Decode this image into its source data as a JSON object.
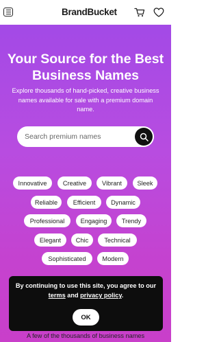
{
  "header": {
    "logo": "BrandBucket"
  },
  "hero": {
    "title_line1": "Your Source for the Best",
    "title_line2": "Business Names",
    "subtitle_line1": "Explore thousands of hand-picked, creative business",
    "subtitle_line2": "names available for sale with a premium domain",
    "subtitle_line3": "name."
  },
  "search": {
    "placeholder": "Search premium names"
  },
  "tags": [
    "Innovative",
    "Creative",
    "Vibrant",
    "Sleek",
    "Reliable",
    "Efficient",
    "Dynamic",
    "Professional",
    "Engaging",
    "Trendy",
    "Elegant",
    "Chic",
    "Technical",
    "Sophisticated",
    "Modern"
  ],
  "below_text": "A few of the thousands of business names",
  "cookie": {
    "text_before": "By continuing to use this site, you agree to our ",
    "terms_link": "terms",
    "text_middle": " and ",
    "privacy_link": "privacy policy",
    "text_after": ".",
    "ok_label": "OK"
  },
  "colors": {
    "gradient_top": "#a34ae6",
    "gradient_bottom": "#c93fca",
    "banner_bg": "#0d0d0d"
  }
}
